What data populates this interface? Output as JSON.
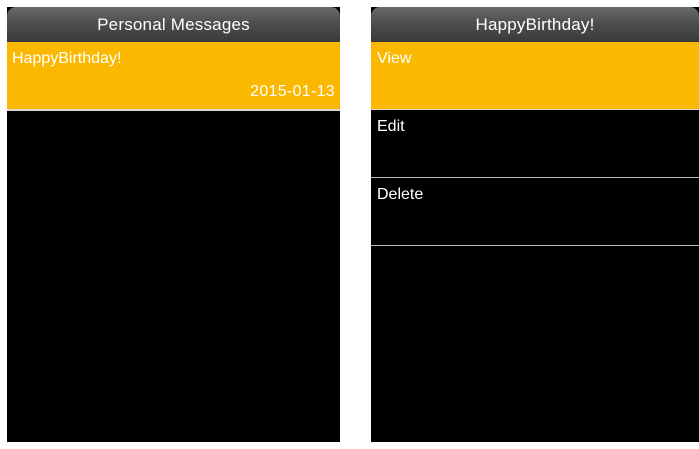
{
  "left_screen": {
    "title": "Personal Messages",
    "messages": [
      {
        "title": "HappyBirthday!",
        "date": "2015-01-13",
        "selected": true
      }
    ]
  },
  "right_screen": {
    "title": "HappyBirthday!",
    "menu": [
      {
        "label": "View",
        "selected": true
      },
      {
        "label": "Edit",
        "selected": false
      },
      {
        "label": "Delete",
        "selected": false
      }
    ]
  },
  "colors": {
    "highlight": "#fbb800",
    "background": "#000000",
    "text": "#ffffff"
  }
}
